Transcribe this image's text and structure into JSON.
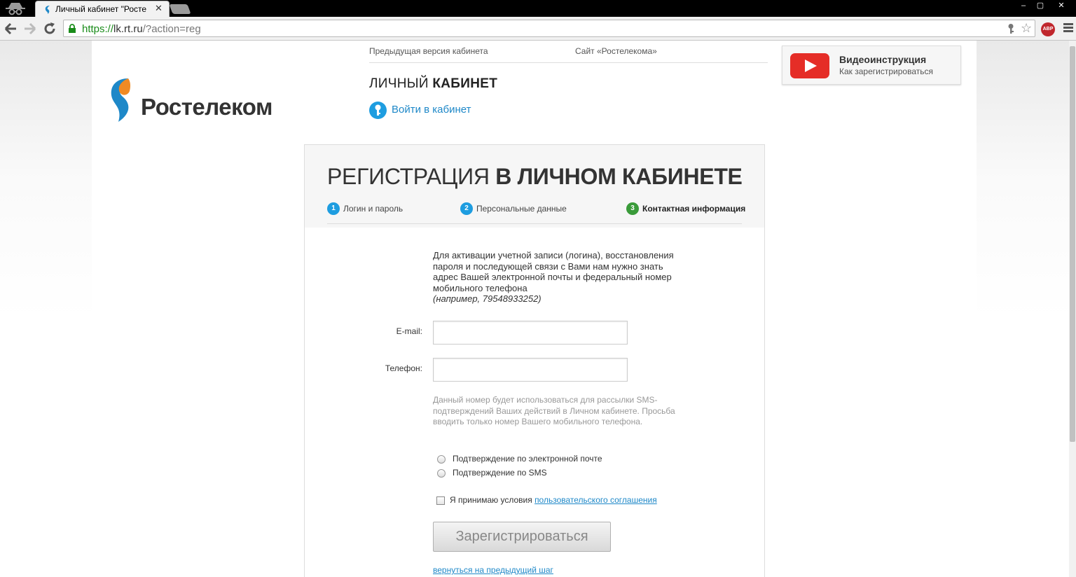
{
  "browser": {
    "tab_title": "Личный кабинет \"Росте",
    "url_scheme": "https://",
    "url_host": "lk.rt.ru",
    "url_path": "/?action=reg",
    "abp_label": "ABP",
    "window_min": "–",
    "window_max": "▢",
    "window_close": "✕"
  },
  "header": {
    "logo_text": "Ростелеком",
    "prev_version_link": "Предыдущая версия кабинета",
    "site_link": "Сайт «Ростелекома»",
    "cabinet_title_light": "ЛИЧНЫЙ ",
    "cabinet_title_bold": "КАБИНЕТ",
    "login_link": "Войти в кабинет"
  },
  "video": {
    "title": "Видеоинструкция",
    "subtitle": "Как зарегистрироваться"
  },
  "registration": {
    "title_light": "РЕГИСТРАЦИЯ ",
    "title_bold": "В ЛИЧНОМ КАБИНЕТЕ",
    "steps": [
      {
        "num": "1",
        "label": "Логин и пароль",
        "color": "#1e9de0"
      },
      {
        "num": "2",
        "label": "Персональные данные",
        "color": "#1e9de0"
      },
      {
        "num": "3",
        "label": "Контактная информация",
        "color": "#3a9b3a"
      }
    ],
    "intro": "Для активации учетной записи (логина), восстановления пароля и последующей связи с Вами нам нужно знать адрес Вашей электронной почты и федеральный номер мобильного телефона",
    "intro_example": "(например, 79548933252)",
    "email_label": "E-mail:",
    "email_value": "",
    "phone_label": "Телефон:",
    "phone_value": "",
    "phone_hint": "Данный номер будет использоваться для рассылки SMS-подтверждений Ваших действий в Личном кабинете. Просьба вводить только номер Вашего мобильного телефона.",
    "radio_email": "Подтверждение по электронной почте",
    "radio_sms": "Подтверждение по SMS",
    "agree_text": "Я принимаю условия ",
    "agree_link": "пользовательского соглашения",
    "register_button": "Зарегистрироваться",
    "back_link": "вернуться на предыдущий шаг"
  },
  "colors": {
    "brand_blue": "#1e88c8",
    "youtube_red": "#e52d27",
    "step_active_green": "#3a9b3a"
  }
}
